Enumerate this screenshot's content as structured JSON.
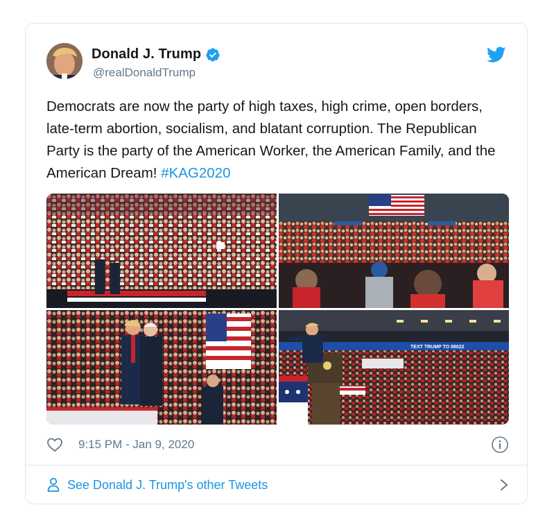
{
  "tweet": {
    "author_name": "Donald J. Trump",
    "author_handle": "@realDonaldTrump",
    "text": "Democrats are now the party of high taxes, high crime, open borders, late-term abortion, socialism, and blatant corruption. The Republican Party is the party of the American Worker, the American Family, and the American Dream! ",
    "hashtag": "#KAG2020",
    "timestamp": "9:15 PM - Jan 9, 2020",
    "footer_link": "See Donald J. Trump's other Tweets",
    "photos": [
      {
        "alt": "rally-crowd-stands-photo"
      },
      {
        "alt": "arena-crowd-with-flag-photo"
      },
      {
        "alt": "trump-and-pence-on-stage-photo"
      },
      {
        "alt": "podium-arena-photo"
      }
    ],
    "banner_text": "TEXT TRUMP TO 88022"
  },
  "colors": {
    "link": "#1b95e0",
    "secondary_text": "#657786",
    "border": "#e1e8ed",
    "verified": "#1da1f2"
  },
  "icons": [
    "twitter-bird-icon",
    "verified-badge-icon",
    "heart-icon",
    "info-icon",
    "person-icon",
    "chevron-right-icon"
  ]
}
